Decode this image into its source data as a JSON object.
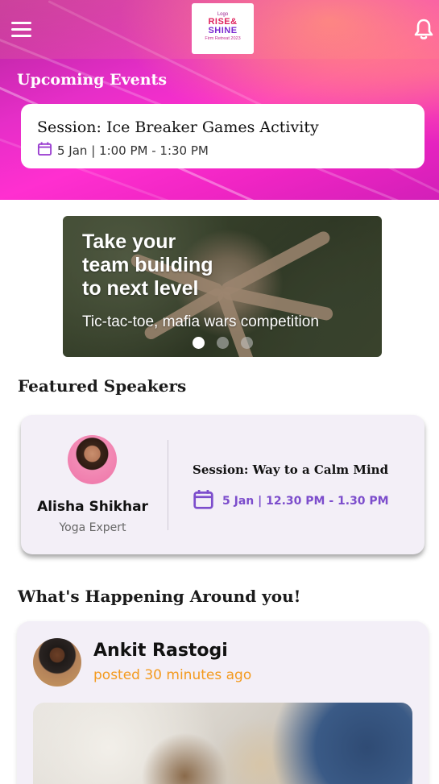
{
  "header": {
    "logo": {
      "line1": "Logo",
      "line2": "RISE&",
      "line3": "SHINE",
      "line4": "Firm Retreat 2023"
    },
    "upcoming_title": "Upcoming Events",
    "event": {
      "title": "Session: Ice Breaker Games Activity",
      "time": "5 Jan | 1:00 PM - 1:30 PM"
    }
  },
  "banner": {
    "headline": "Take your\nteam building\nto next level",
    "subtitle": "Tic-tac-toe, mafia wars competition",
    "slide_count": 3,
    "active_slide": 1
  },
  "featured": {
    "title": "Featured Speakers",
    "speaker": {
      "name": "Alisha Shikhar",
      "role": "Yoga Expert",
      "session": "Session: Way to a Calm Mind",
      "time": "5 Jan | 12.30 PM - 1.30 PM"
    }
  },
  "happening": {
    "title": "What's Happening Around you!",
    "post": {
      "author": "Ankit Rastogi",
      "posted": "posted 30 minutes ago"
    }
  },
  "colors": {
    "accent_purple": "#7c4dcc",
    "accent_orange": "#f39a1e",
    "hero_magenta": "#e62ec8"
  }
}
